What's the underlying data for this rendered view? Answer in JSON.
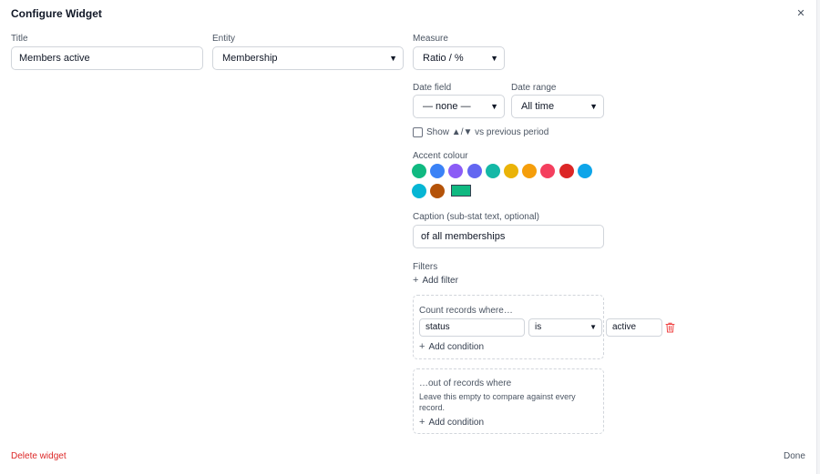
{
  "dialog": {
    "title": "Configure Widget",
    "close_icon": "close-icon"
  },
  "form": {
    "title_label": "Title",
    "title_value": "Members active",
    "entity_label": "Entity",
    "entity_value": "Membership",
    "measure_label": "Measure",
    "measure_value": "Ratio / %",
    "date_field_label": "Date field",
    "date_field_value": "— none —",
    "date_range_label": "Date range",
    "date_range_value": "All time",
    "compare_label": "Show ▲/▼ vs previous period",
    "compare_checked": false,
    "accent_label": "Accent colour",
    "accent_colors": [
      "#10b981",
      "#3b82f6",
      "#8b5cf6",
      "#6366f1",
      "#14b8a6",
      "#eab308",
      "#f59e0b",
      "#f43f5e",
      "#dc2626",
      "#0ea5e9",
      "#06b6d4",
      "#b45309"
    ],
    "selected_accent": "#10b981",
    "caption_label": "Caption (sub-stat text, optional)",
    "caption_value": "of all memberships"
  },
  "filters": {
    "label": "Filters",
    "add_filter": "Add filter",
    "count_box": {
      "title": "Count records where…",
      "condition": {
        "field": "status",
        "operator": "is",
        "value": "active"
      },
      "add_condition": "Add condition"
    },
    "out_of_box": {
      "title": "…out of records where",
      "hint": "Leave this empty to compare against every record.",
      "add_condition": "Add condition"
    }
  },
  "footer": {
    "delete": "Delete widget",
    "done": "Done"
  }
}
